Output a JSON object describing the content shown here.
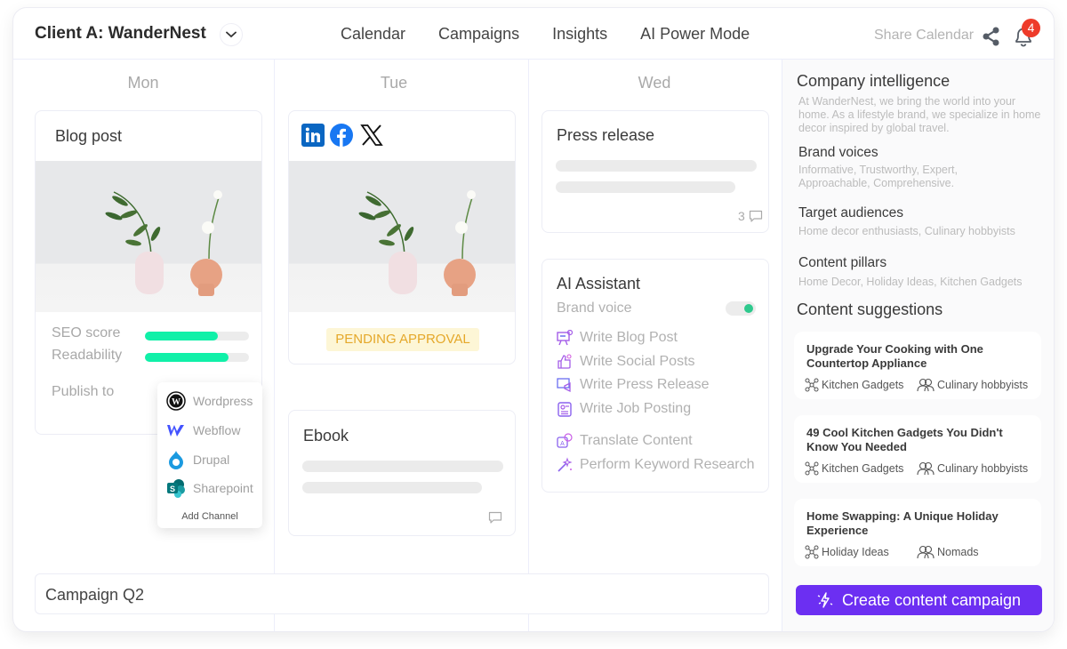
{
  "header": {
    "client_title": "Client A: WanderNest",
    "nav": [
      "Calendar",
      "Campaigns",
      "Insights",
      "AI Power Mode"
    ],
    "share_label": "Share Calendar",
    "notification_count": "4"
  },
  "days": [
    "Mon",
    "Tue",
    "Wed"
  ],
  "blog_card": {
    "title": "Blog post",
    "seo_label": "SEO score",
    "seo_value": 0.7,
    "readability_label": "Readability",
    "readability_value": 0.8,
    "publish_label": "Publish to",
    "channels": [
      "Wordpress",
      "Webflow",
      "Drupal",
      "Sharepoint"
    ],
    "add_channel": "Add Channel"
  },
  "social_card": {
    "networks": [
      "linkedin",
      "facebook",
      "x"
    ],
    "status": "PENDING APPROVAL"
  },
  "ebook_card": {
    "title": "Ebook"
  },
  "press_card": {
    "title": "Press release",
    "comments": "3"
  },
  "ai_assistant": {
    "title": "AI Assistant",
    "brand_voice_label": "Brand voice",
    "brand_voice_on": true,
    "actions": [
      "Write Blog Post",
      "Write Social Posts",
      "Write Press Release",
      "Write Job Posting",
      "Translate Content",
      "Perform Keyword Research"
    ]
  },
  "campaign_name": "Campaign Q2",
  "sidebar": {
    "company_title": "Company intelligence",
    "company_text": "At WanderNest, we bring the world into your home. As a lifestyle brand, we specialize in home decor inspired by global travel.",
    "brand_voices_title": "Brand voices",
    "brand_voices_text": "Informative, Trustworthy, Expert, Approachable, Comprehensive.",
    "audiences_title": "Target audiences",
    "audiences_text": "Home decor enthusiasts, Culinary hobbyists",
    "pillars_title": "Content pillars",
    "pillars_text": "Home Decor, Holiday Ideas, Kitchen Gadgets",
    "suggestions_title": "Content suggestions",
    "suggestions": [
      {
        "title": "Upgrade Your Cooking with One Countertop Appliance",
        "pillar": "Kitchen Gadgets",
        "audience": "Culinary hobbyists"
      },
      {
        "title": "49 Cool Kitchen Gadgets You Didn't Know You Needed",
        "pillar": "Kitchen Gadgets",
        "audience": "Culinary hobbyists"
      },
      {
        "title": "Home Swapping: A Unique Holiday Experience",
        "pillar": "Holiday Ideas",
        "audience": "Nomads"
      }
    ],
    "cta_label": "Create content campaign"
  },
  "colors": {
    "accent": "#6c2ff2",
    "progress": "#10f0a8",
    "badge": "#ee3b2a",
    "pending_bg": "#fdf6d6",
    "pending_text": "#e5a82a"
  }
}
